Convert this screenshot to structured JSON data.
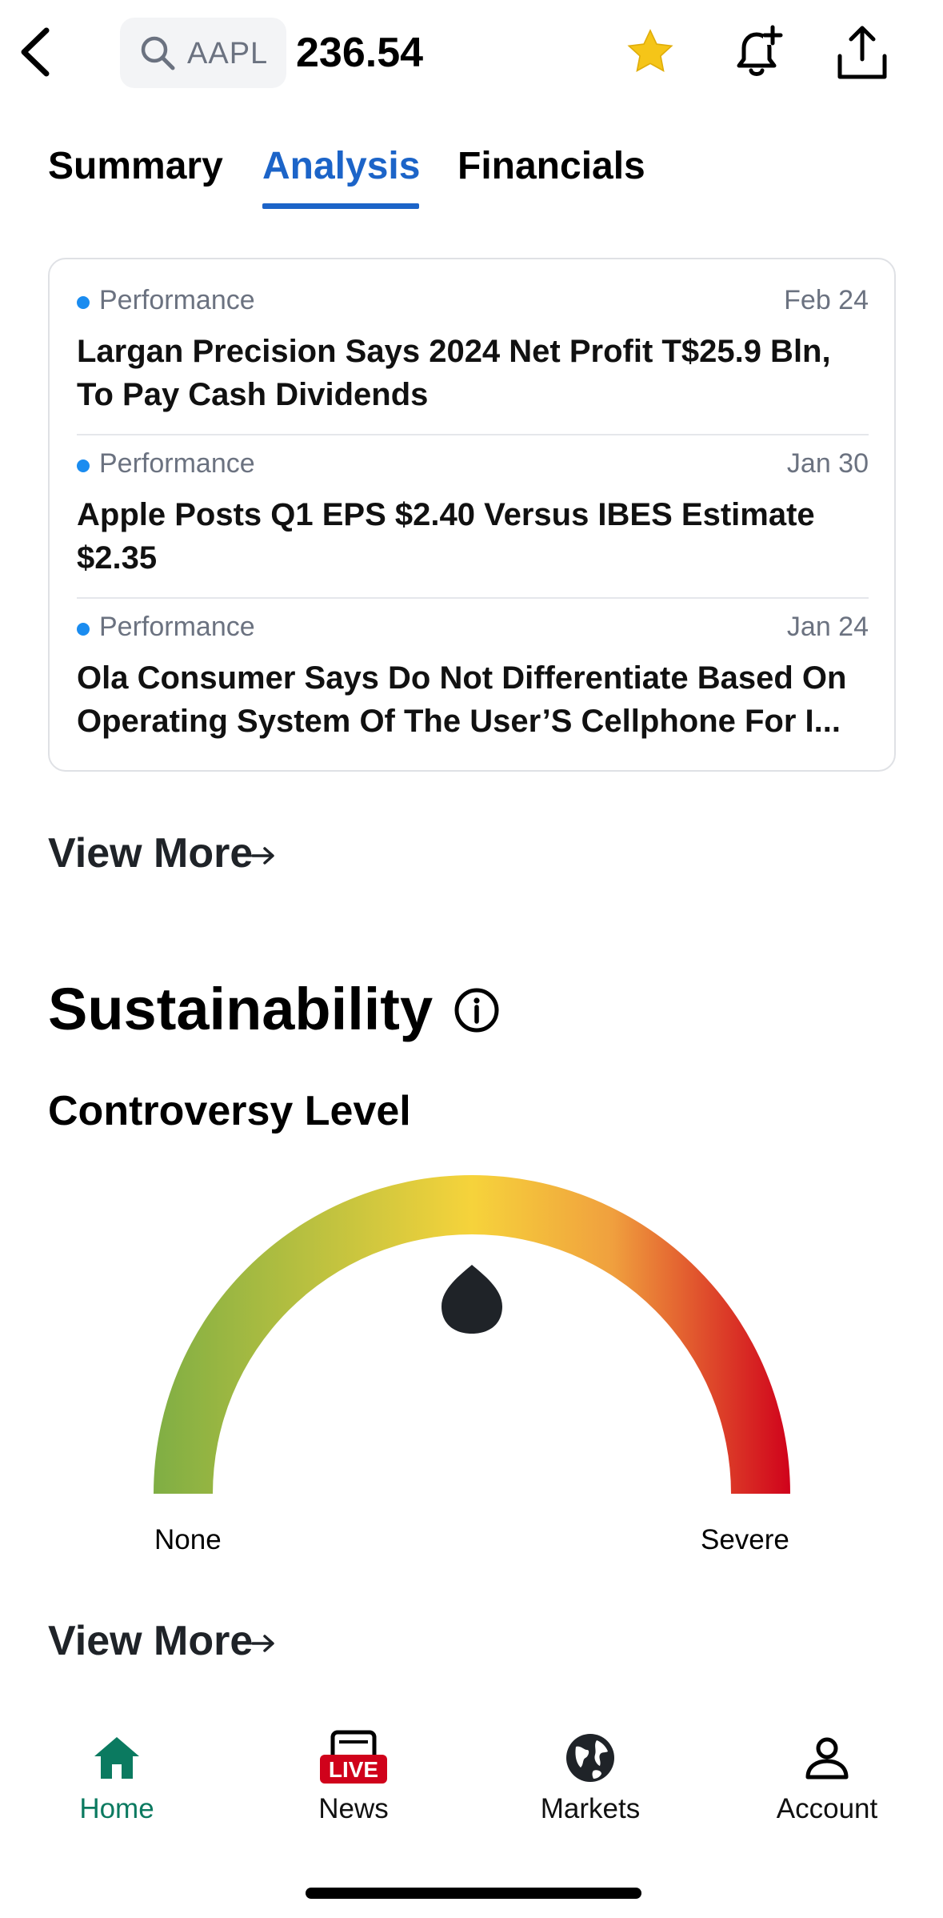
{
  "header": {
    "search_symbol": "AAPL",
    "price": "236.54",
    "icons": [
      "back-chevron-icon",
      "search-icon",
      "star-icon",
      "add-alert-bell-icon",
      "share-icon"
    ],
    "star_color": "#f5c518"
  },
  "tabs": [
    {
      "label": "Summary",
      "active": false
    },
    {
      "label": "Analysis",
      "active": true
    },
    {
      "label": "Financials",
      "active": false
    }
  ],
  "accent": "#1c64c8",
  "news": [
    {
      "category": "Performance",
      "date": "Feb 24",
      "title": "Largan Precision Says 2024 Net Profit T$25.9 Bln, To Pay Cash Dividends"
    },
    {
      "category": "Performance",
      "date": "Jan 30",
      "title": "Apple Posts Q1 EPS $2.40 Versus IBES Estimate $2.35"
    },
    {
      "category": "Performance",
      "date": "Jan 24",
      "title": "Ola Consumer Says Do Not Differentiate Based On Operating System Of The User’S Cellphone For I..."
    }
  ],
  "view_more_label": "View More",
  "sustainability": {
    "title": "Sustainability",
    "controversy_label": "Controversy Level",
    "gauge_min_label": "None",
    "gauge_max_label": "Severe",
    "gauge_level": 0.5,
    "gauge_colors": [
      "#7fae44",
      "#f6d33b",
      "#f0a03e",
      "#d0021b"
    ]
  },
  "bottom_nav": [
    {
      "label": "Home",
      "icon": "home-icon",
      "active": true
    },
    {
      "label": "News",
      "icon": "live-news-icon",
      "badge": "LIVE",
      "active": false
    },
    {
      "label": "Markets",
      "icon": "globe-icon",
      "active": false
    },
    {
      "label": "Account",
      "icon": "account-icon",
      "active": false
    }
  ],
  "active_nav_color": "#0b7a60"
}
